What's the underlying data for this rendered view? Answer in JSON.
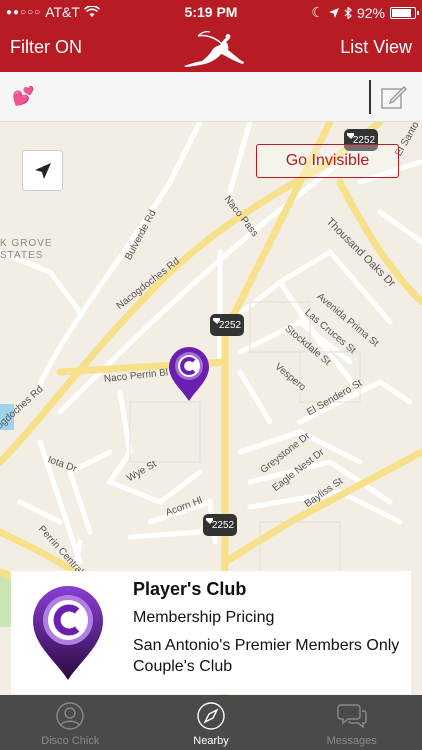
{
  "status": {
    "carrier": "AT&T",
    "time": "5:19 PM",
    "battery": "92%",
    "battery_level": 0.92
  },
  "nav": {
    "left_label": "Filter ON",
    "right_label": "List View",
    "logo_icon": "woman-silhouette-logo"
  },
  "message_bar": {
    "emoji": "💕",
    "compose_icon": "compose-icon"
  },
  "map": {
    "invisible_label": "Go Invisible",
    "locate_icon": "location-arrow-icon",
    "road_labels": [
      "Bulverde Rd",
      "Nacogdoches Rd",
      "Naco Pass",
      "Thousand Oaks Dr",
      "Avenida Prima St",
      "Las Cruces St",
      "Stockdale St",
      "Vespero",
      "El Sendero St",
      "Naco Perrin Bl",
      "ogdoches Rd",
      "Iota Dr",
      "Wye St",
      "Acorn Hl",
      "Greystone Dr",
      "Eagle Nest Dr",
      "Bayliss St",
      "Perrin Central Bl",
      "El Santo H",
      "K GROVE",
      "STATES"
    ],
    "highway_shields": [
      "2252",
      "2252",
      "2252"
    ],
    "accent_color": "#7b2fbf"
  },
  "card": {
    "title": "Player's Club",
    "subtitle": "Membership Pricing",
    "description": "San Antonio's Premier Members Only Couple's Club"
  },
  "tabs": [
    {
      "label": "Disco Chick",
      "icon": "person-icon",
      "active": false
    },
    {
      "label": "Nearby",
      "icon": "compass-icon",
      "active": true
    },
    {
      "label": "Messages",
      "icon": "chat-bubbles-icon",
      "active": false
    }
  ],
  "colors": {
    "brand_red": "#b71c24",
    "tab_bar": "#4a4a4a",
    "road_yellow": "#f6e08a"
  }
}
